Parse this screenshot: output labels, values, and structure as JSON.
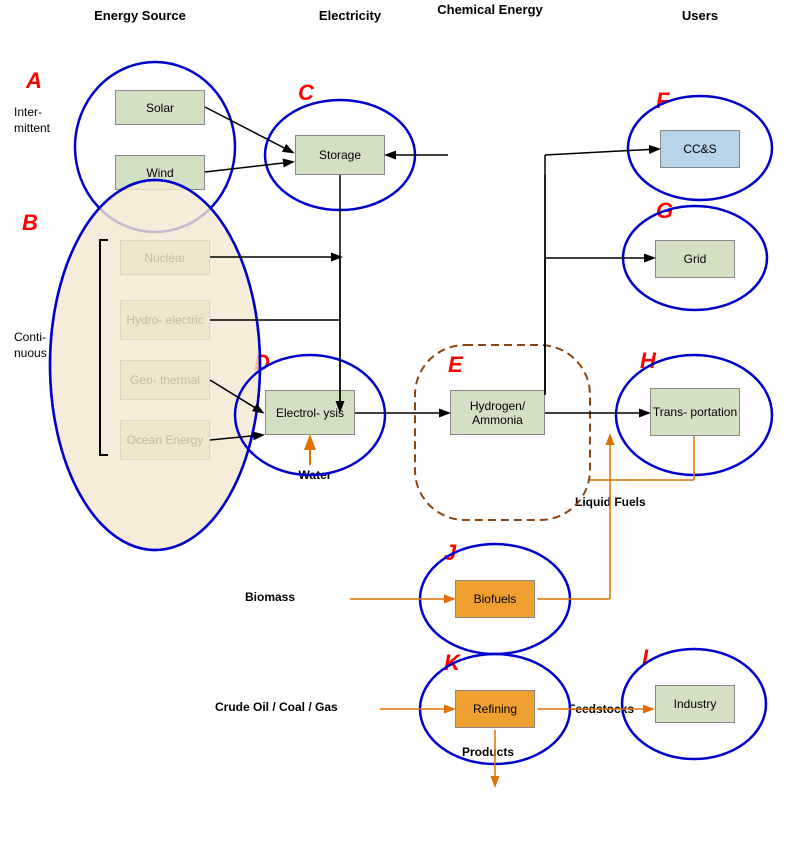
{
  "headers": {
    "energy_source": "Energy Source",
    "electricity": "Electricity",
    "chemical_energy": "Chemical Energy",
    "users": "Users"
  },
  "groups": {
    "A": {
      "label": "A",
      "sublabel": "Inter-\nmittent"
    },
    "B": {
      "label": "B",
      "sublabel": "Conti-\nnuous"
    },
    "C": {
      "label": "C"
    },
    "D": {
      "label": "D"
    },
    "E": {
      "label": "E"
    },
    "F": {
      "label": "F"
    },
    "G": {
      "label": "G"
    },
    "H": {
      "label": "H"
    },
    "I": {
      "label": "I"
    },
    "J": {
      "label": "J"
    },
    "K": {
      "label": "K"
    }
  },
  "boxes": {
    "solar": "Solar",
    "wind": "Wind",
    "nuclear": "Nuclear",
    "hydro": "Hydro-\nelectric",
    "geo": "Geo-\nthermal",
    "ocean": "Ocean\nEnergy",
    "storage": "Storage",
    "electrolysis": "Electrol-\nysis",
    "hydrogen": "Hydrogen/\nAmmonia",
    "ccs": "CC&S",
    "grid": "Grid",
    "transport": "Trans-\nportation",
    "biofuels": "Biofuels",
    "refining": "Refining",
    "industry": "Industry"
  },
  "labels": {
    "water": "Water",
    "biomass": "Biomass",
    "crude": "Crude Oil / Coal / Gas",
    "liquid_fuels": "Liquid Fuels",
    "feedstocks": "Feedstocks",
    "products": "Products"
  }
}
